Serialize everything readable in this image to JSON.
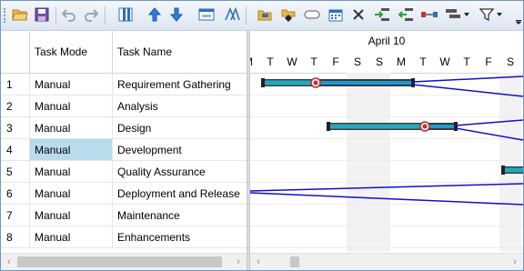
{
  "toolbar": {
    "buttons": [
      {
        "name": "open-folder-icon"
      },
      {
        "name": "save-icon"
      },
      {
        "name": "undo-icon"
      },
      {
        "name": "redo-icon"
      },
      {
        "name": "columns-icon"
      },
      {
        "name": "move-up-icon"
      },
      {
        "name": "move-down-icon"
      },
      {
        "name": "task-information-icon"
      },
      {
        "name": "text-styles-icon"
      },
      {
        "name": "add-task-icon"
      },
      {
        "name": "add-milestone-icon"
      },
      {
        "name": "summary-task-icon"
      },
      {
        "name": "calendar-icon"
      },
      {
        "name": "delete-icon"
      },
      {
        "name": "indent-icon"
      },
      {
        "name": "outdent-icon"
      },
      {
        "name": "link-tasks-icon"
      },
      {
        "name": "view-options-icon"
      },
      {
        "name": "filter-icon"
      }
    ]
  },
  "grid": {
    "columns": [
      "Task Mode",
      "Task Name"
    ],
    "rows": [
      {
        "id": "1",
        "mode": "Manual",
        "name": "Requirement Gathering"
      },
      {
        "id": "2",
        "mode": "Manual",
        "name": "Analysis"
      },
      {
        "id": "3",
        "mode": "Manual",
        "name": "Design"
      },
      {
        "id": "4",
        "mode": "Manual",
        "name": "Development",
        "selected": true
      },
      {
        "id": "5",
        "mode": "Manual",
        "name": "Quality Assurance"
      },
      {
        "id": "6",
        "mode": "Manual",
        "name": "Deployment and Release"
      },
      {
        "id": "7",
        "mode": "Manual",
        "name": "Maintenance"
      },
      {
        "id": "8",
        "mode": "Manual",
        "name": "Enhancements"
      }
    ]
  },
  "chart": {
    "date_header": "April 10",
    "days": [
      "M",
      "T",
      "W",
      "T",
      "F",
      "S",
      "S",
      "M",
      "T",
      "W",
      "T",
      "F",
      "S"
    ],
    "weekend_indices": [
      5,
      6,
      12
    ],
    "bar_color": "#1a9bd7",
    "link_color": "#1010c8"
  },
  "scroll": {
    "left_arrow": "‹",
    "right_arrow": "›"
  }
}
